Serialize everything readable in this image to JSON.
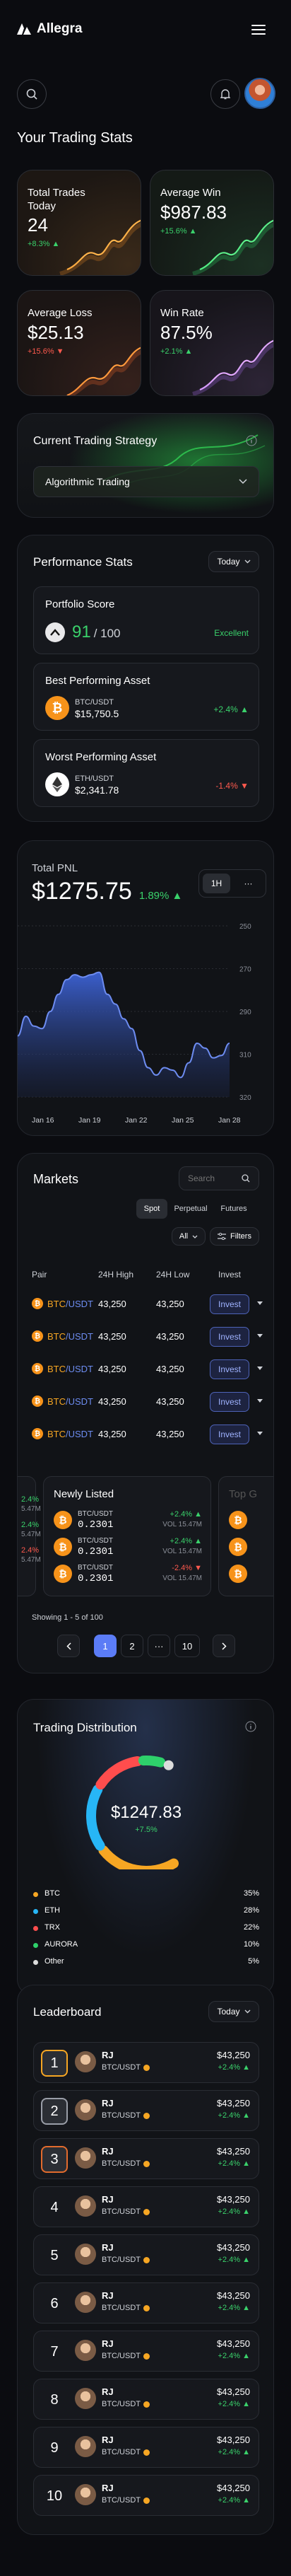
{
  "app": {
    "name": "Allegra"
  },
  "page_title": "Your Trading Stats",
  "stats": [
    {
      "label": "Total Trades Today",
      "value": "24",
      "change": "+8.3%",
      "dir": "up",
      "theme": "orange"
    },
    {
      "label": "Average Win",
      "value": "$987.83",
      "change": "+15.6%",
      "dir": "up",
      "theme": "green"
    },
    {
      "label": "Average Loss",
      "value": "$25.13",
      "change": "+15.6%",
      "dir": "down",
      "theme": "red"
    },
    {
      "label": "Win Rate",
      "value": "87.5%",
      "change": "+2.1%",
      "dir": "up",
      "theme": "purple"
    }
  ],
  "strategy": {
    "title": "Current Trading Strategy",
    "selected": "Algorithmic Trading"
  },
  "performance": {
    "title": "Performance Stats",
    "period": "Today",
    "score": {
      "label": "Portfolio Score",
      "value": "91",
      "max": "/ 100",
      "rating": "Excellent"
    },
    "best": {
      "label": "Best Performing Asset",
      "pair": "BTC/USDT",
      "price": "$15,750.5",
      "change": "+2.4%"
    },
    "worst": {
      "label": "Worst Performing Asset",
      "pair": "ETH/USDT",
      "price": "$2,341.78",
      "change": "-1.4%"
    }
  },
  "pnl": {
    "label": "Total PNL",
    "value": "$1275.75",
    "change": "1.89%",
    "ranges": [
      "1H",
      "···"
    ],
    "chart_data": {
      "type": "area",
      "x": [
        "Jan 16",
        "Jan 19",
        "Jan 22",
        "Jan 25",
        "Jan 28"
      ],
      "y_ticks": [
        "250",
        "270",
        "290",
        "310",
        "320"
      ],
      "values": [
        275,
        283,
        279,
        278,
        285,
        292,
        298,
        300,
        299,
        300,
        301,
        292,
        288,
        282,
        278,
        269,
        262,
        259,
        262,
        261,
        258,
        264,
        272,
        270,
        266,
        267,
        272
      ]
    }
  },
  "markets": {
    "title": "Markets",
    "search_placeholder": "Search",
    "tabs": [
      "Spot",
      "Perpetual",
      "Futures"
    ],
    "filter_all": "All",
    "filters_label": "Filters",
    "columns": [
      "Pair",
      "24H High",
      "24H Low",
      "Invest"
    ],
    "rows": [
      {
        "base": "BTC",
        "quote": "/USDT",
        "high": "43,250",
        "low": "43,250",
        "action": "Invest"
      },
      {
        "base": "BTC",
        "quote": "/USDT",
        "high": "43,250",
        "low": "43,250",
        "action": "Invest"
      },
      {
        "base": "BTC",
        "quote": "/USDT",
        "high": "43,250",
        "low": "43,250",
        "action": "Invest"
      },
      {
        "base": "BTC",
        "quote": "/USDT",
        "high": "43,250",
        "low": "43,250",
        "action": "Invest"
      },
      {
        "base": "BTC",
        "quote": "/USDT",
        "high": "43,250",
        "low": "43,250",
        "action": "Invest"
      }
    ],
    "listed": {
      "title": "Newly Listed",
      "next_title": "Top G",
      "items": [
        {
          "pair": "BTC/USDT",
          "price": "0.2301",
          "change": "+2.4%",
          "vol": "VOL 15.47M"
        },
        {
          "pair": "BTC/USDT",
          "price": "0.2301",
          "change": "+2.4%",
          "vol": "VOL 15.47M"
        },
        {
          "pair": "BTC/USDT",
          "price": "0.2301",
          "change": "-2.4%",
          "vol": "VOL 15.47M"
        }
      ],
      "left_items": [
        {
          "change": "2.4%",
          "vol": "5.47M"
        },
        {
          "change": "2.4%",
          "vol": "5.47M"
        },
        {
          "change": "2.4%",
          "vol": "5.47M"
        }
      ]
    },
    "pagination": {
      "info": "Showing 1 - 5 of 100",
      "pages": [
        "1",
        "2",
        "···",
        "10"
      ]
    }
  },
  "distribution": {
    "title": "Trading Distribution",
    "total": "$1247.83",
    "change": "+7.5%",
    "items": [
      {
        "name": "BTC",
        "pct": "35%",
        "color": "#f6a623",
        "value": 35
      },
      {
        "name": "ETH",
        "pct": "28%",
        "color": "#27b6f6",
        "value": 28
      },
      {
        "name": "TRX",
        "pct": "22%",
        "color": "#ff4d4d",
        "value": 22
      },
      {
        "name": "AURORA",
        "pct": "10%",
        "color": "#2ed16b",
        "value": 10
      },
      {
        "name": "Other",
        "pct": "5%",
        "color": "#dcdcdc",
        "value": 5
      }
    ]
  },
  "leaderboard": {
    "title": "Leaderboard",
    "period": "Today",
    "rows": [
      {
        "rank": "1",
        "name": "RJ",
        "pair": "BTC/USDT",
        "value": "$43,250",
        "change": "+2.4%"
      },
      {
        "rank": "2",
        "name": "RJ",
        "pair": "BTC/USDT",
        "value": "$43,250",
        "change": "+2.4%"
      },
      {
        "rank": "3",
        "name": "RJ",
        "pair": "BTC/USDT",
        "value": "$43,250",
        "change": "+2.4%"
      },
      {
        "rank": "4",
        "name": "RJ",
        "pair": "BTC/USDT",
        "value": "$43,250",
        "change": "+2.4%"
      },
      {
        "rank": "5",
        "name": "RJ",
        "pair": "BTC/USDT",
        "value": "$43,250",
        "change": "+2.4%"
      },
      {
        "rank": "6",
        "name": "RJ",
        "pair": "BTC/USDT",
        "value": "$43,250",
        "change": "+2.4%"
      },
      {
        "rank": "7",
        "name": "RJ",
        "pair": "BTC/USDT",
        "value": "$43,250",
        "change": "+2.4%"
      },
      {
        "rank": "8",
        "name": "RJ",
        "pair": "BTC/USDT",
        "value": "$43,250",
        "change": "+2.4%"
      },
      {
        "rank": "9",
        "name": "RJ",
        "pair": "BTC/USDT",
        "value": "$43,250",
        "change": "+2.4%"
      },
      {
        "rank": "10",
        "name": "RJ",
        "pair": "BTC/USDT",
        "value": "$43,250",
        "change": "+2.4%"
      }
    ]
  }
}
